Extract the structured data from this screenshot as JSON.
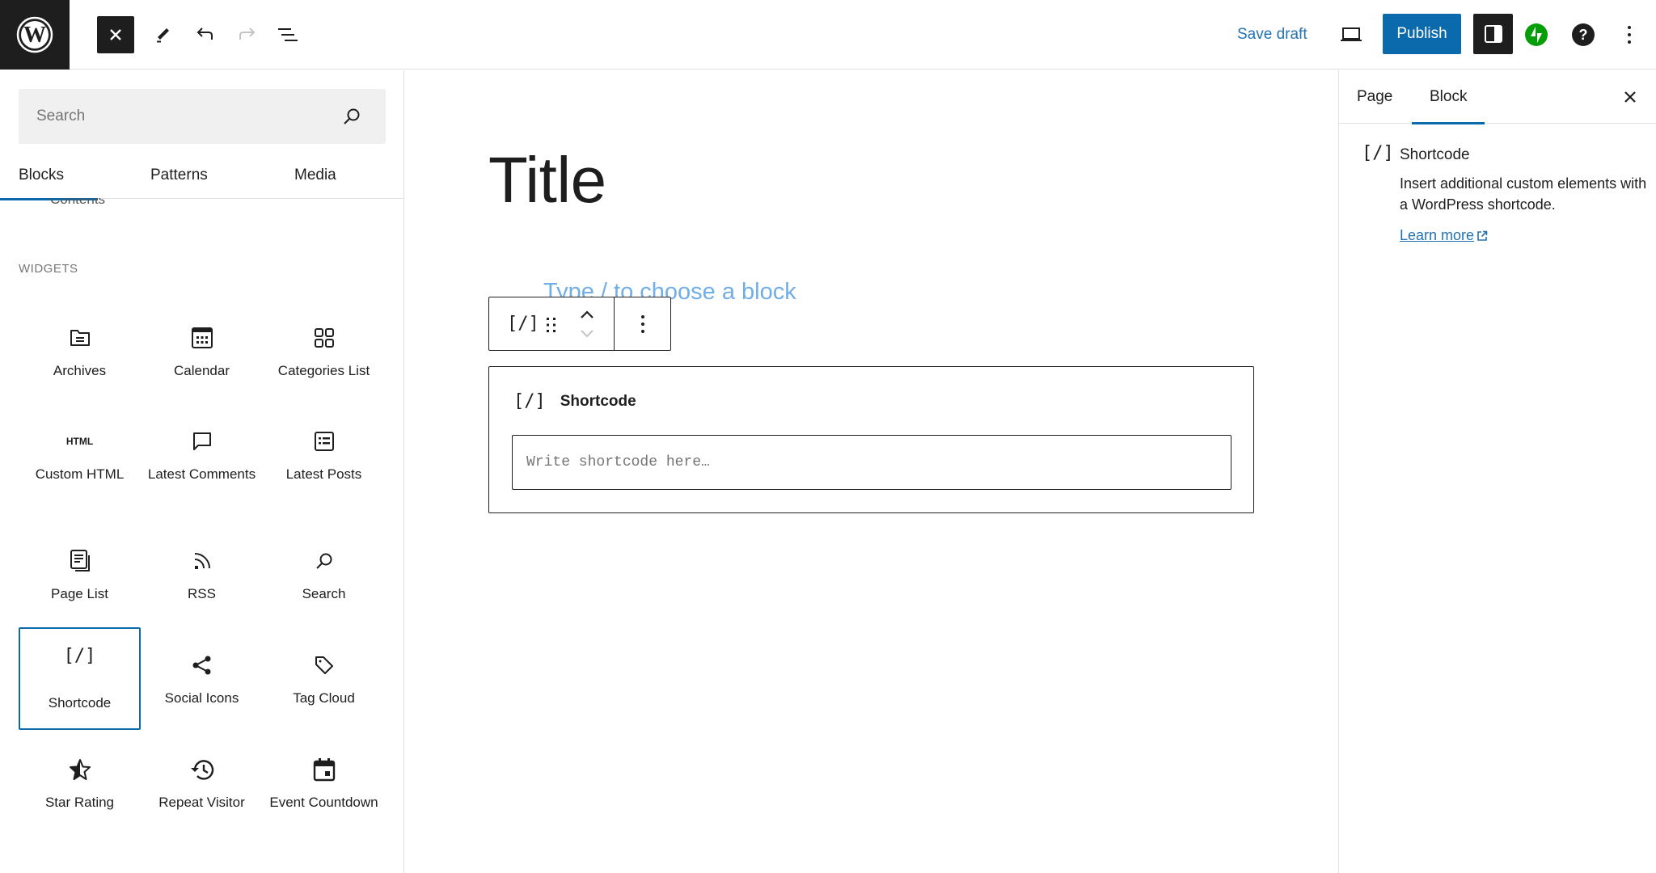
{
  "header": {
    "logo_icon": "wordpress-logo-icon",
    "close_icon": "close-icon",
    "tools_icon": "pencil-icon",
    "undo_icon": "undo-icon",
    "redo_icon": "redo-icon",
    "list_view_icon": "list-view-icon",
    "save_draft_label": "Save draft",
    "preview_icon": "laptop-icon",
    "publish_label": "Publish",
    "settings_icon": "sidebar-toggle-icon",
    "jetpack_icon": "jetpack-icon",
    "help_icon": "help-icon",
    "more_icon": "vertical-ellipsis-icon",
    "colors": {
      "publish_bg": "#0a6aac",
      "save_draft": "#2271b1",
      "jetpack": "#069e08",
      "dark": "#1e1e1e"
    }
  },
  "inserter": {
    "search_placeholder": "Search",
    "tabs": [
      {
        "label": "Blocks",
        "active": true
      },
      {
        "label": "Patterns",
        "active": false
      },
      {
        "label": "Media",
        "active": false
      }
    ],
    "peek_text": "Contents",
    "section_heading": "WIDGETS",
    "blocks": [
      {
        "label": "Archives",
        "icon": "archive-folder-icon"
      },
      {
        "label": "Calendar",
        "icon": "calendar-icon"
      },
      {
        "label": "Categories List",
        "icon": "categories-grid-icon"
      },
      {
        "label": "Custom HTML",
        "icon": "html-icon",
        "icon_text": "HTML"
      },
      {
        "label": "Latest Comments",
        "icon": "comment-icon"
      },
      {
        "label": "Latest Posts",
        "icon": "post-list-icon"
      },
      {
        "label": "Page List",
        "icon": "page-list-icon"
      },
      {
        "label": "RSS",
        "icon": "rss-icon"
      },
      {
        "label": "Search",
        "icon": "search-icon"
      },
      {
        "label": "Shortcode",
        "icon": "shortcode-icon",
        "selected": true,
        "icon_text": "[/]"
      },
      {
        "label": "Social Icons",
        "icon": "share-icon"
      },
      {
        "label": "Tag Cloud",
        "icon": "tag-icon"
      },
      {
        "label": "Star Rating",
        "icon": "star-half-icon"
      },
      {
        "label": "Repeat Visitor",
        "icon": "history-icon"
      },
      {
        "label": "Event Countdown",
        "icon": "calendar-event-icon"
      }
    ]
  },
  "editor": {
    "title": "Title",
    "placeholder": "Type / to choose a block",
    "toolbar": {
      "block_icon_text": "[/]",
      "drag_icon": "drag-handle-icon",
      "move_up_icon": "chevron-up-icon",
      "move_down_icon": "chevron-down-icon",
      "options_icon": "vertical-ellipsis-icon"
    },
    "shortcode_block": {
      "icon_text": "[/]",
      "label": "Shortcode",
      "input_value": "",
      "input_placeholder": "Write shortcode here…"
    }
  },
  "settings_panel": {
    "tabs": [
      {
        "label": "Page",
        "active": false
      },
      {
        "label": "Block",
        "active": true
      }
    ],
    "close_icon": "close-icon",
    "block_card": {
      "icon_text": "[/]",
      "title": "Shortcode",
      "description": "Insert additional custom elements with a WordPress shortcode.",
      "learn_more_label": "Learn more",
      "external_icon": "external-link-icon"
    }
  }
}
